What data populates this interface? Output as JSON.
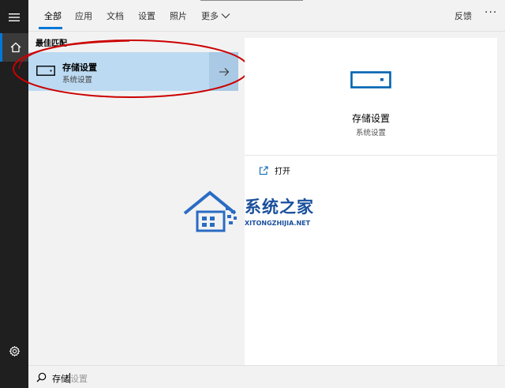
{
  "header": {
    "tabs": [
      {
        "label": "全部",
        "active": true
      },
      {
        "label": "应用"
      },
      {
        "label": "文档"
      },
      {
        "label": "设置"
      },
      {
        "label": "照片"
      },
      {
        "label": "更多"
      }
    ],
    "feedback_label": "反馈",
    "more_options_label": "···"
  },
  "results": {
    "section_title": "最佳匹配",
    "best_match": {
      "title": "存储设置",
      "subtitle": "系统设置",
      "icon": "storage-drive-icon"
    }
  },
  "detail": {
    "title": "存储设置",
    "subtitle": "系统设置",
    "icon": "storage-drive-icon",
    "actions": [
      {
        "label": "打开",
        "icon": "open-external-icon"
      }
    ]
  },
  "search": {
    "typed": "存储",
    "suggestion": "设置",
    "icon": "search-icon"
  },
  "watermark": {
    "text": "系统之家",
    "subtext": "XITONGZHIJIA.NET"
  },
  "colors": {
    "accent": "#0078d7",
    "selected_bg": "#bcdaf2",
    "arrow_bg": "#a9c9e4",
    "rail_bg": "#1f1f1f",
    "annotation": "#cc0000",
    "watermark": "#1a4f9c"
  }
}
